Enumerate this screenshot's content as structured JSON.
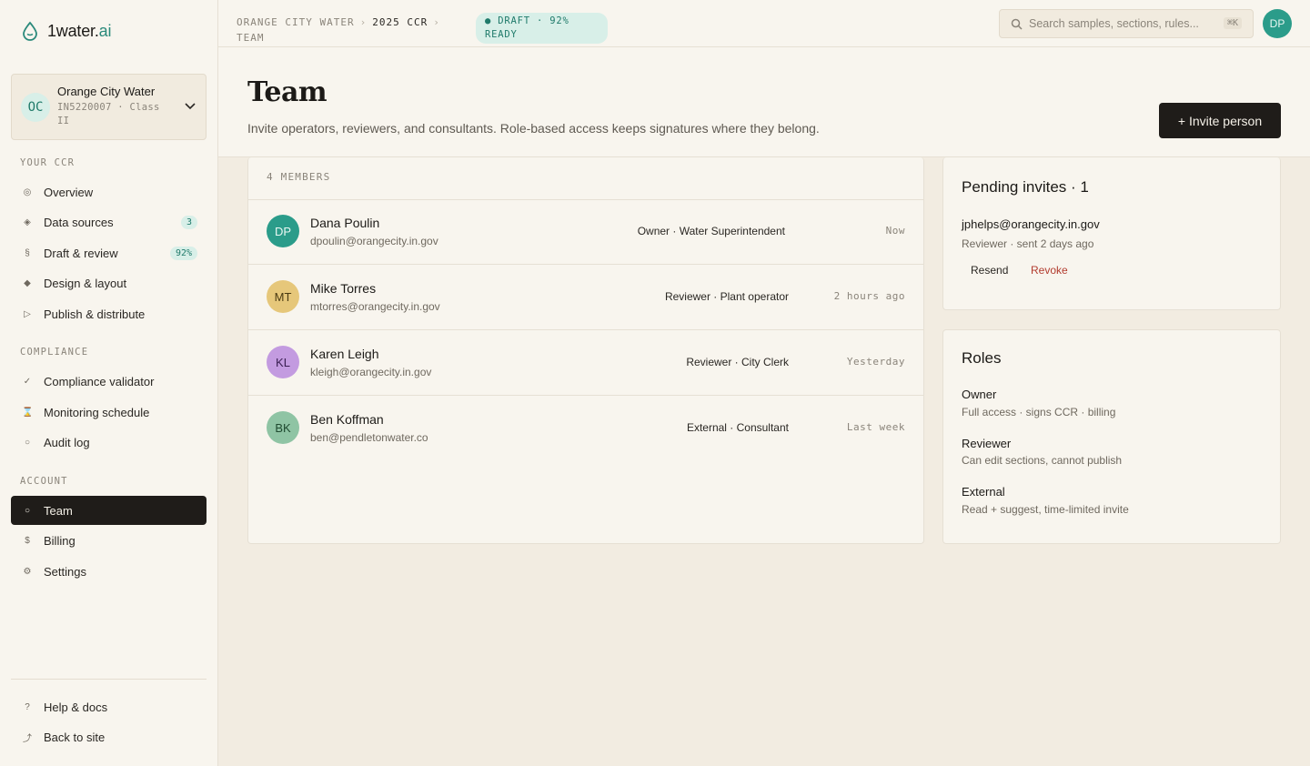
{
  "brand": {
    "name_main": "1water.",
    "name_accent": "ai"
  },
  "org": {
    "initials": "OC",
    "name": "Orange City Water",
    "meta": "IN5220007 · Class II"
  },
  "sidebar": {
    "sections": {
      "your_ccr": "YOUR CCR",
      "compliance": "COMPLIANCE",
      "account": "ACCOUNT"
    },
    "items": [
      {
        "label": "Overview",
        "icon": "◎"
      },
      {
        "label": "Data sources",
        "icon": "◈",
        "badge": "3"
      },
      {
        "label": "Draft & review",
        "icon": "§",
        "badge": "92%"
      },
      {
        "label": "Design & layout",
        "icon": "◆"
      },
      {
        "label": "Publish & distribute",
        "icon": "▷"
      },
      {
        "label": "Compliance validator",
        "icon": "✓"
      },
      {
        "label": "Monitoring schedule",
        "icon": "⌛"
      },
      {
        "label": "Audit log",
        "icon": "○"
      },
      {
        "label": "Team",
        "icon": "○"
      },
      {
        "label": "Billing",
        "icon": "$"
      },
      {
        "label": "Settings",
        "icon": "⚙"
      },
      {
        "label": "Help & docs",
        "icon": "?"
      },
      {
        "label": "Back to site",
        "icon": "⤴"
      }
    ]
  },
  "topbar": {
    "crumb_1": "ORANGE CITY WATER",
    "crumb_sep": "›",
    "crumb_2": "2025 CCR",
    "crumb_3": "TEAM",
    "status": "● DRAFT · 92% READY",
    "search_placeholder": "Search samples, sections, rules...",
    "search_kbd": "⌘K",
    "user_initials": "DP"
  },
  "page": {
    "title": "Team",
    "subtitle": "Invite operators, reviewers, and consultants. Role-based access keeps signatures where they belong.",
    "invite_label": "+ Invite person"
  },
  "members": {
    "count_label": "4 MEMBERS",
    "rows": [
      {
        "initials": "DP",
        "name": "Dana Poulin",
        "email": "dpoulin@orangecity.in.gov",
        "role": "Owner · Water Superintendent",
        "time": "Now",
        "avatar_bg": "#2b9c8a",
        "avatar_fg": "#e9f7f3"
      },
      {
        "initials": "MT",
        "name": "Mike Torres",
        "email": "mtorres@orangecity.in.gov",
        "role": "Reviewer · Plant operator",
        "time": "2 hours ago",
        "avatar_bg": "#e6c77a",
        "avatar_fg": "#4a3a12"
      },
      {
        "initials": "KL",
        "name": "Karen Leigh",
        "email": "kleigh@orangecity.in.gov",
        "role": "Reviewer · City Clerk",
        "time": "Yesterday",
        "avatar_bg": "#c39be0",
        "avatar_fg": "#3a1f52"
      },
      {
        "initials": "BK",
        "name": "Ben Koffman",
        "email": "ben@pendletonwater.co",
        "role": "External · Consultant",
        "time": "Last week",
        "avatar_bg": "#8fc4a4",
        "avatar_fg": "#1f4a30"
      }
    ]
  },
  "pending": {
    "title": "Pending invites · 1",
    "email": "jphelps@orangecity.in.gov",
    "meta": "Reviewer · sent 2 days ago",
    "resend": "Resend",
    "revoke": "Revoke"
  },
  "roles": {
    "title": "Roles",
    "items": [
      {
        "name": "Owner",
        "desc": "Full access · signs CCR · billing"
      },
      {
        "name": "Reviewer",
        "desc": "Can edit sections, cannot publish"
      },
      {
        "name": "External",
        "desc": "Read + suggest, time-limited invite"
      }
    ]
  },
  "colors": {
    "accent": "#2b8a7b",
    "active_nav": "#1f1c19",
    "revoke": "#b23b2e"
  }
}
